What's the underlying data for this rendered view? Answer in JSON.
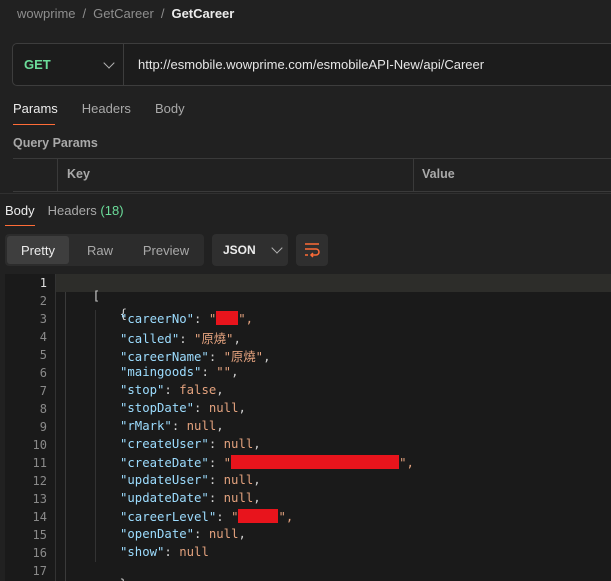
{
  "breadcrumb": [
    "wowprime",
    "GetCareer",
    "GetCareer"
  ],
  "request": {
    "method": "GET",
    "url": "http://esmobile.wowprime.com/esmobileAPI-New/api/Career"
  },
  "request_tabs": [
    "Params",
    "Headers",
    "Body"
  ],
  "query_params": {
    "title": "Query Params",
    "columns": [
      "Key",
      "Value"
    ]
  },
  "response_tabs": {
    "body": "Body",
    "headers": "Headers",
    "headers_count": "(18)"
  },
  "view_modes": [
    "Pretty",
    "Raw",
    "Preview"
  ],
  "format": "JSON",
  "colors": {
    "accent": "#ff6c37",
    "method_get": "#6bdd9a",
    "json_key": "#9cdcfe",
    "json_value": "#e3a27e",
    "redaction": "#e8141c"
  },
  "code": {
    "line_numbers": [
      "1",
      "2",
      "3",
      "4",
      "5",
      "6",
      "7",
      "8",
      "9",
      "10",
      "11",
      "12",
      "13",
      "14",
      "15",
      "16",
      "17"
    ],
    "open_bracket": "[",
    "open_brace": "{",
    "close_brace": "},",
    "lines": [
      {
        "key": "\"careerNo\"",
        "value": "\"",
        "value_end": "\",",
        "redacted": true
      },
      {
        "key": "\"called\"",
        "value": "\"原燒\"",
        "tail": ","
      },
      {
        "key": "\"careerName\"",
        "value": "\"原燒\"",
        "tail": ","
      },
      {
        "key": "\"maingoods\"",
        "value": "\"\"",
        "tail": ","
      },
      {
        "key": "\"stop\"",
        "value": "false",
        "tail": ","
      },
      {
        "key": "\"stopDate\"",
        "value": "null",
        "tail": ","
      },
      {
        "key": "\"rMark\"",
        "value": "null",
        "tail": ","
      },
      {
        "key": "\"createUser\"",
        "value": "null",
        "tail": ","
      },
      {
        "key": "\"createDate\"",
        "value": "\"",
        "value_end": "\",",
        "redacted": true
      },
      {
        "key": "\"updateUser\"",
        "value": "null",
        "tail": ","
      },
      {
        "key": "\"updateDate\"",
        "value": "null",
        "tail": ","
      },
      {
        "key": "\"careerLevel\"",
        "value": "\"",
        "value_end": "\",",
        "redacted": true
      },
      {
        "key": "\"openDate\"",
        "value": "null",
        "tail": ","
      },
      {
        "key": "\"show\"",
        "value": "null",
        "tail": ""
      }
    ]
  }
}
